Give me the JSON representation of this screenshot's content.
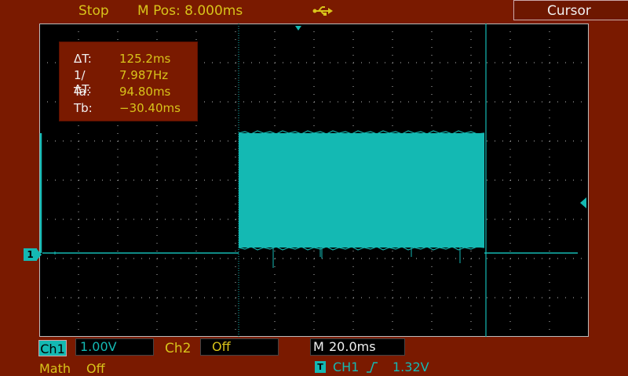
{
  "top_bar": {
    "status": "Stop",
    "mpos_label": "M Pos:",
    "mpos_value": "8.000ms",
    "usb_icon": "usb-icon",
    "mode": "Cursor"
  },
  "readout": {
    "delta_t_label": "ΔT:",
    "delta_t_value": "125.2ms",
    "inv_delta_t_label": "1/ ΔT:",
    "inv_delta_t_value": "7.987Hz",
    "ta_label": "Ta:",
    "ta_value": "94.80ms",
    "tb_label": "Tb:",
    "tb_value": "−30.40ms"
  },
  "channel_marker": "1",
  "bottom_bar": {
    "ch1_label": "Ch1",
    "ch1_scale": "1.00V",
    "ch2_label": "Ch2",
    "ch2_value": "Off",
    "timebase_prefix": "M",
    "timebase_value": "20.0ms",
    "math_label": "Math",
    "math_value": "Off",
    "trigger_badge": "T",
    "trigger_source": "CH1",
    "trigger_edge_icon": "rising-edge-icon",
    "trigger_level": "1.32V"
  },
  "colors": {
    "background": "#7a1a00",
    "label_yellow": "#d8c31a",
    "trace_cyan": "#14b9b3",
    "grid": "#bbbbbb"
  }
}
